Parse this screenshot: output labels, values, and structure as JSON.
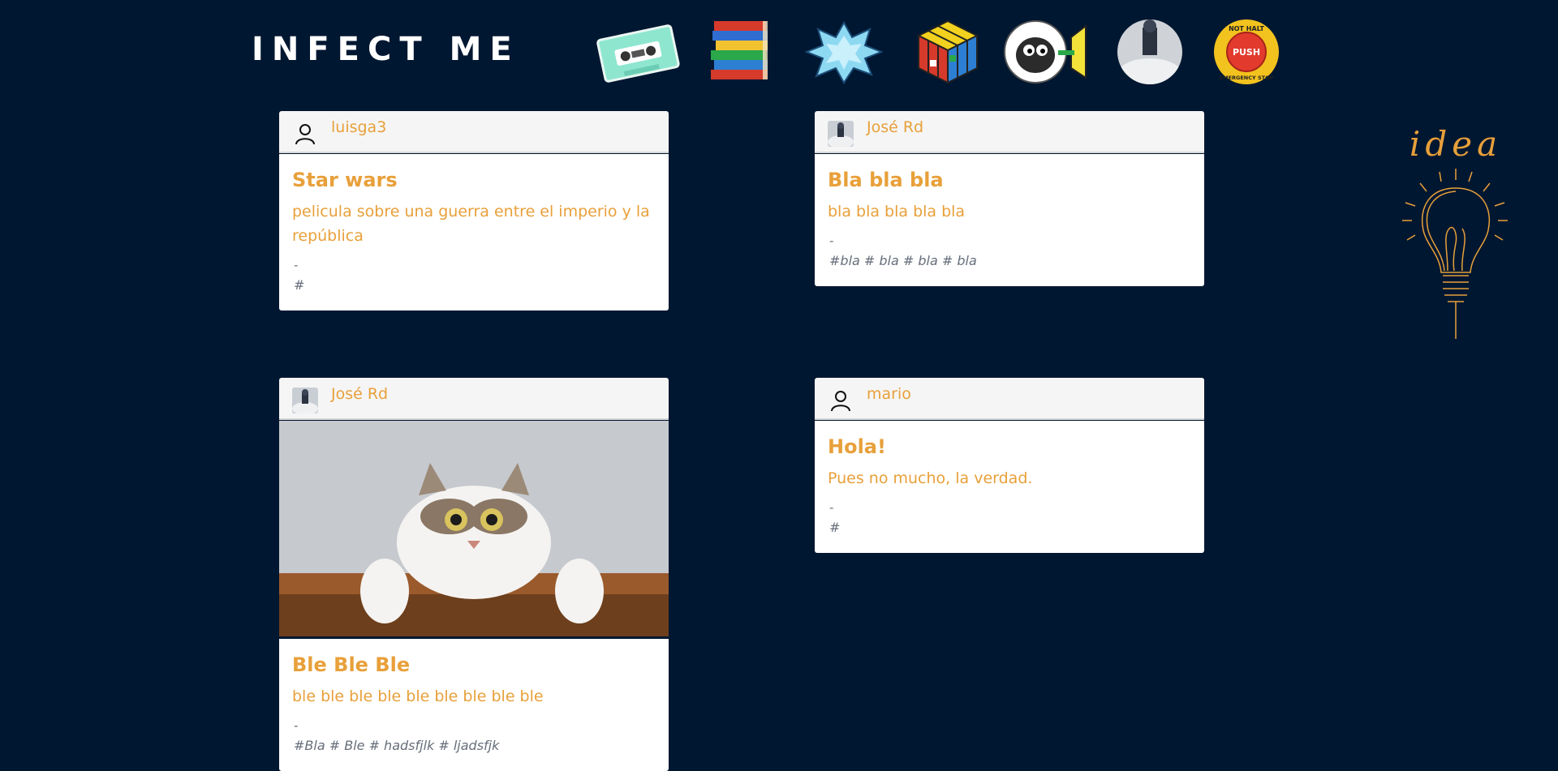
{
  "header": {
    "logo": "INFECT ME",
    "nav": [
      {
        "name": "cassette"
      },
      {
        "name": "books"
      },
      {
        "name": "splash"
      },
      {
        "name": "rubik-cube"
      },
      {
        "name": "sheep"
      },
      {
        "name": "snow-avatar"
      },
      {
        "name": "emergency-stop",
        "text_top": "NOT HALT",
        "text_mid": "PUSH",
        "text_bottom": "EMERGENCY STOP"
      }
    ]
  },
  "posts": [
    {
      "user": "luisga3",
      "title": "Star wars",
      "text": "pelicula sobre una guerra entre el imperio y la república",
      "sep": "-",
      "tags": "#"
    },
    {
      "user": "José Rd",
      "title": "Bla bla bla",
      "text": "bla bla bla bla bla",
      "sep": "-",
      "tags": "#bla # bla # bla # bla"
    },
    {
      "user": "José Rd",
      "title": "Ble Ble Ble",
      "text": "ble ble ble ble ble ble ble ble ble",
      "sep": "-",
      "tags": "#Bla # Ble # hadsfjlk # ljadsfjk"
    },
    {
      "user": "mario",
      "title": "Hola!",
      "text": "Pues no mucho, la verdad.",
      "sep": "-",
      "tags": "#"
    }
  ],
  "sidebar": {
    "idea_label": "idea"
  },
  "colors": {
    "background": "#001731",
    "accent": "#e8a03a",
    "card": "#ffffff",
    "card_header": "#f5f5f5"
  }
}
